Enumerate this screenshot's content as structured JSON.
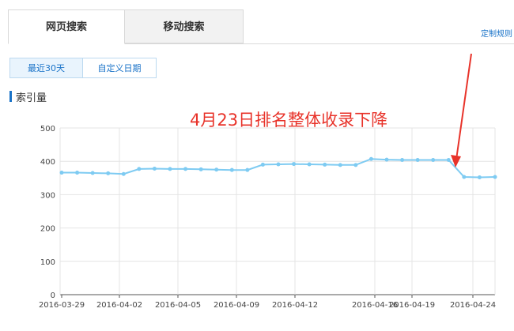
{
  "tabs": [
    {
      "label": "网页搜索",
      "active": true
    },
    {
      "label": "移动搜索",
      "active": false
    }
  ],
  "rule_link": "定制规则",
  "ranges": {
    "recent": "最近30天",
    "custom": "自定义日期"
  },
  "section_title": "索引量",
  "annotation": "4月23日排名整体收录下降",
  "colors": {
    "accent": "#1a73c8",
    "line": "#7ecbf2",
    "annotation": "#e8332a"
  },
  "chart_data": {
    "type": "line",
    "x": [
      "2016-03-29",
      "2016-03-30",
      "2016-03-31",
      "2016-04-01",
      "2016-04-02",
      "2016-04-03",
      "2016-04-04",
      "2016-04-05",
      "2016-04-06",
      "2016-04-07",
      "2016-04-08",
      "2016-04-09",
      "2016-04-10",
      "2016-04-11",
      "2016-04-12",
      "2016-04-13",
      "2016-04-14",
      "2016-04-15",
      "2016-04-16",
      "2016-04-17",
      "2016-04-18",
      "2016-04-19",
      "2016-04-20",
      "2016-04-21",
      "2016-04-22",
      "2016-04-23",
      "2016-04-24",
      "2016-04-25"
    ],
    "series": [
      {
        "values": [
          366,
          366,
          365,
          364,
          362,
          377,
          378,
          377,
          377,
          376,
          375,
          374,
          374,
          390,
          391,
          392,
          391,
          390,
          389,
          389,
          407,
          405,
          404,
          404,
          404,
          404,
          353,
          352,
          353
        ]
      }
    ],
    "tick_labels": [
      "2016-03-29",
      "2016-04-02",
      "2016-04-05",
      "2016-04-09",
      "2016-04-12",
      "2016-04-16",
      "2016-04-19",
      "2016-04-24"
    ],
    "ylim": [
      0,
      500
    ],
    "yticks": [
      0,
      100,
      200,
      300,
      400,
      500
    ],
    "grid": true
  }
}
